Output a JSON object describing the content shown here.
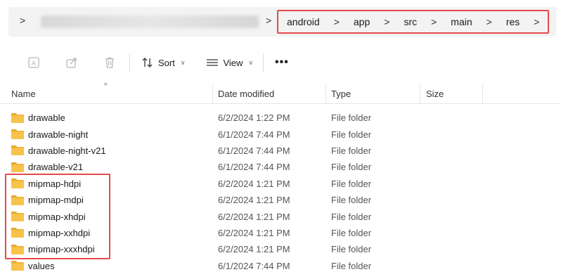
{
  "address_bar": {
    "chevron": ">",
    "breadcrumbs": [
      "android",
      "app",
      "src",
      "main",
      "res"
    ],
    "separator": ">"
  },
  "toolbar": {
    "icons": [
      "rename-icon",
      "share-icon",
      "delete-icon"
    ],
    "sort_label": "Sort",
    "view_label": "View",
    "more_label": "•••",
    "caret": "∨"
  },
  "columns": {
    "name": "Name",
    "date": "Date modified",
    "type": "Type",
    "size": "Size"
  },
  "files": [
    {
      "name": "drawable",
      "date": "6/2/2024 1:22 PM",
      "type": "File folder"
    },
    {
      "name": "drawable-night",
      "date": "6/1/2024 7:44 PM",
      "type": "File folder"
    },
    {
      "name": "drawable-night-v21",
      "date": "6/1/2024 7:44 PM",
      "type": "File folder"
    },
    {
      "name": "drawable-v21",
      "date": "6/1/2024 7:44 PM",
      "type": "File folder"
    },
    {
      "name": "mipmap-hdpi",
      "date": "6/2/2024 1:21 PM",
      "type": "File folder"
    },
    {
      "name": "mipmap-mdpi",
      "date": "6/2/2024 1:21 PM",
      "type": "File folder"
    },
    {
      "name": "mipmap-xhdpi",
      "date": "6/2/2024 1:21 PM",
      "type": "File folder"
    },
    {
      "name": "mipmap-xxhdpi",
      "date": "6/2/2024 1:21 PM",
      "type": "File folder"
    },
    {
      "name": "mipmap-xxxhdpi",
      "date": "6/2/2024 1:21 PM",
      "type": "File folder"
    },
    {
      "name": "values",
      "date": "6/1/2024 7:44 PM",
      "type": "File folder"
    }
  ],
  "colors": {
    "highlight": "#e5484d",
    "folder": "#f7c34a"
  }
}
